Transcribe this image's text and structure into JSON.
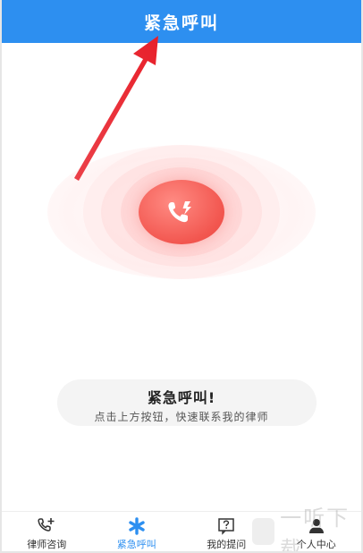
{
  "header": {
    "title": "紧急呼叫",
    "background_color": "#2d8ff0"
  },
  "call_button": {
    "icon": "phone-call-icon",
    "color": "#f2564f"
  },
  "info": {
    "title": "紧急呼叫!",
    "subtitle": "点击上方按钮，快速联系我的律师"
  },
  "tabbar": {
    "active_color": "#2d8ff0",
    "items": [
      {
        "label": "律师咨询",
        "icon": "phone-plus-icon"
      },
      {
        "label": "紧急呼叫",
        "icon": "asterisk-icon"
      },
      {
        "label": "我的提问",
        "icon": "question-box-icon"
      },
      {
        "label": "个人中心",
        "icon": "person-icon"
      }
    ]
  },
  "annotation": {
    "arrow_color": "#e8202a"
  },
  "watermark": {
    "text": "一听下载"
  }
}
